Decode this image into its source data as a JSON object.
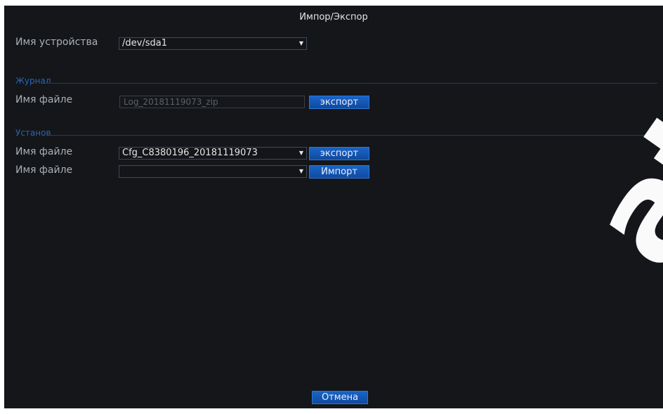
{
  "dialog": {
    "title": "Импор/Экспор",
    "cancel_label": "Отмена"
  },
  "device": {
    "label": "Имя устройства",
    "selected": "/dev/sda1"
  },
  "log_section": {
    "title": "Журнал",
    "file_label": "Имя файле",
    "file_value": "Log_20181119073_zip",
    "export_label": "экспорт"
  },
  "settings_section": {
    "title": "Установ",
    "export_row": {
      "file_label": "Имя файле",
      "selected": "Cfg_C8380196_20181119073",
      "export_label": "экспорт"
    },
    "import_row": {
      "file_label": "Имя файле",
      "selected": "",
      "import_label": "Импорт"
    }
  },
  "icons": {
    "dropdown": "chevron-down-icon"
  },
  "watermark": {
    "text": "ate"
  },
  "colors": {
    "background": "#14161a",
    "accent_button": "#1a64c6",
    "section_title": "#2a64b0"
  }
}
